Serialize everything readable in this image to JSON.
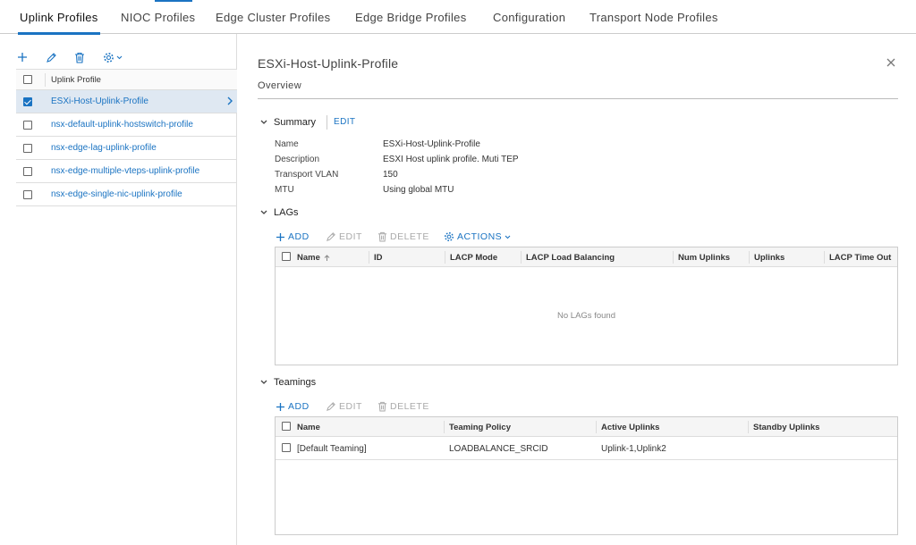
{
  "tabs": [
    {
      "label": "Uplink Profiles",
      "active": true
    },
    {
      "label": "NIOC Profiles"
    },
    {
      "label": "Edge Cluster Profiles"
    },
    {
      "label": "Edge Bridge Profiles"
    },
    {
      "label": "Configuration"
    },
    {
      "label": "Transport Node Profiles"
    }
  ],
  "left": {
    "toolbar": {
      "add_icon": "plus-icon",
      "edit_icon": "pencil-icon",
      "delete_icon": "trash-icon",
      "settings_icon": "gear-icon"
    },
    "column_header": "Uplink Profile",
    "profiles": [
      {
        "name": "ESXi-Host-Uplink-Profile",
        "selected": true
      },
      {
        "name": "nsx-default-uplink-hostswitch-profile"
      },
      {
        "name": "nsx-edge-lag-uplink-profile"
      },
      {
        "name": "nsx-edge-multiple-vteps-uplink-profile"
      },
      {
        "name": "nsx-edge-single-nic-uplink-profile"
      }
    ]
  },
  "detail": {
    "title": "ESXi-Host-Uplink-Profile",
    "overview_tab": "Overview",
    "summary": {
      "title": "Summary",
      "edit": "EDIT",
      "fields": [
        {
          "label": "Name",
          "value": "ESXi-Host-Uplink-Profile"
        },
        {
          "label": "Description",
          "value": "ESXI Host uplink profile. Muti TEP"
        },
        {
          "label": "Transport VLAN",
          "value": "150"
        },
        {
          "label": "MTU",
          "value": "Using global MTU"
        }
      ]
    },
    "lags": {
      "title": "LAGs",
      "actions": {
        "add": "ADD",
        "edit": "EDIT",
        "delete": "DELETE",
        "actions": "ACTIONS"
      },
      "columns": [
        "Name",
        "ID",
        "LACP Mode",
        "LACP Load Balancing",
        "Num Uplinks",
        "Uplinks",
        "LACP Time Out"
      ],
      "empty": "No LAGs found"
    },
    "teamings": {
      "title": "Teamings",
      "actions": {
        "add": "ADD",
        "edit": "EDIT",
        "delete": "DELETE"
      },
      "columns": [
        "Name",
        "Teaming Policy",
        "Active Uplinks",
        "Standby Uplinks"
      ],
      "rows": [
        {
          "name": "[Default Teaming]",
          "policy": "LOADBALANCE_SRCID",
          "active": "Uplink-1,Uplink2",
          "standby": ""
        }
      ]
    }
  },
  "colors": {
    "accent": "#1a73c2",
    "selected_row": "#dfe8f2"
  }
}
